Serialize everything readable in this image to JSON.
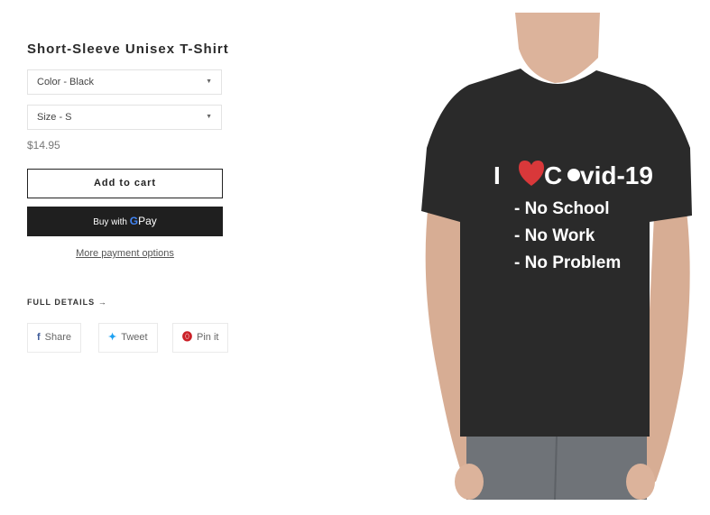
{
  "product": {
    "title": "Short-Sleeve Unisex T-Shirt",
    "color_select": "Color - Black",
    "size_select": "Size - S",
    "price": "$14.95",
    "add_to_cart": "Add to cart",
    "gpay_prefix": "Buy with",
    "gpay_g": "G",
    "gpay_pay": "Pay",
    "more_payment": "More payment options",
    "full_details": "FULL DETAILS",
    "full_details_arrow": "→"
  },
  "share": {
    "facebook": "Share",
    "twitter": "Tweet",
    "pinterest": "Pin it"
  },
  "shirt_print": {
    "line1_i": "I",
    "line1_c": "C",
    "line1_rest": "vid-19",
    "line2": "- No School",
    "line3": "- No Work",
    "line4": "- No Problem"
  },
  "colors": {
    "shirt": "#2a2a2a",
    "skin": "#dcb39b",
    "heart": "#d9383a",
    "jeans": "#6f7378"
  }
}
